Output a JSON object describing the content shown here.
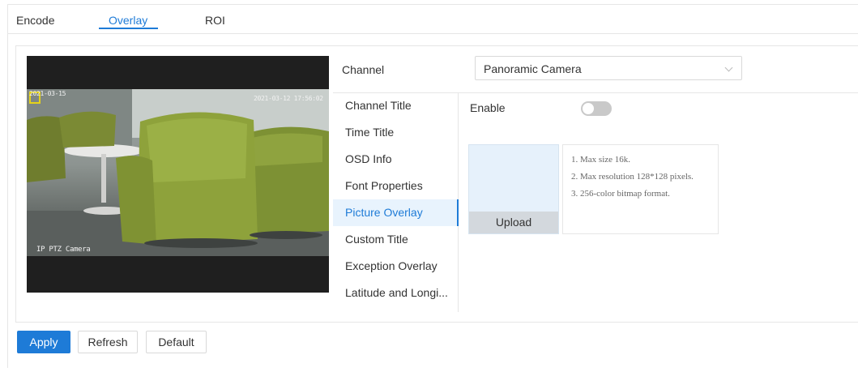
{
  "tabs": [
    {
      "label": "Encode"
    },
    {
      "label": "Overlay"
    },
    {
      "label": "ROI"
    }
  ],
  "active_tab": "Overlay",
  "accent_color": "#1e7bd7",
  "preview": {
    "osd_top_left": "2021-03-15",
    "osd_top_right": "2021-03-12 17:56:02",
    "osd_bottom_left": "IP PTZ Camera"
  },
  "channel": {
    "label": "Channel",
    "value": "Panoramic Camera"
  },
  "menu": {
    "items": [
      {
        "label": "Channel Title"
      },
      {
        "label": "Time Title"
      },
      {
        "label": "OSD Info"
      },
      {
        "label": "Font Properties"
      },
      {
        "label": "Picture Overlay"
      },
      {
        "label": "Custom Title"
      },
      {
        "label": "Exception Overlay"
      },
      {
        "label": "Latitude and Longi..."
      }
    ],
    "active": "Picture Overlay"
  },
  "enable": {
    "label": "Enable",
    "on": false
  },
  "upload": {
    "button_label": "Upload",
    "hints": [
      "1. Max size 16k.",
      "2. Max resolution 128*128 pixels.",
      "3. 256-color bitmap format."
    ]
  },
  "footer": {
    "apply": "Apply",
    "refresh": "Refresh",
    "default": "Default"
  }
}
